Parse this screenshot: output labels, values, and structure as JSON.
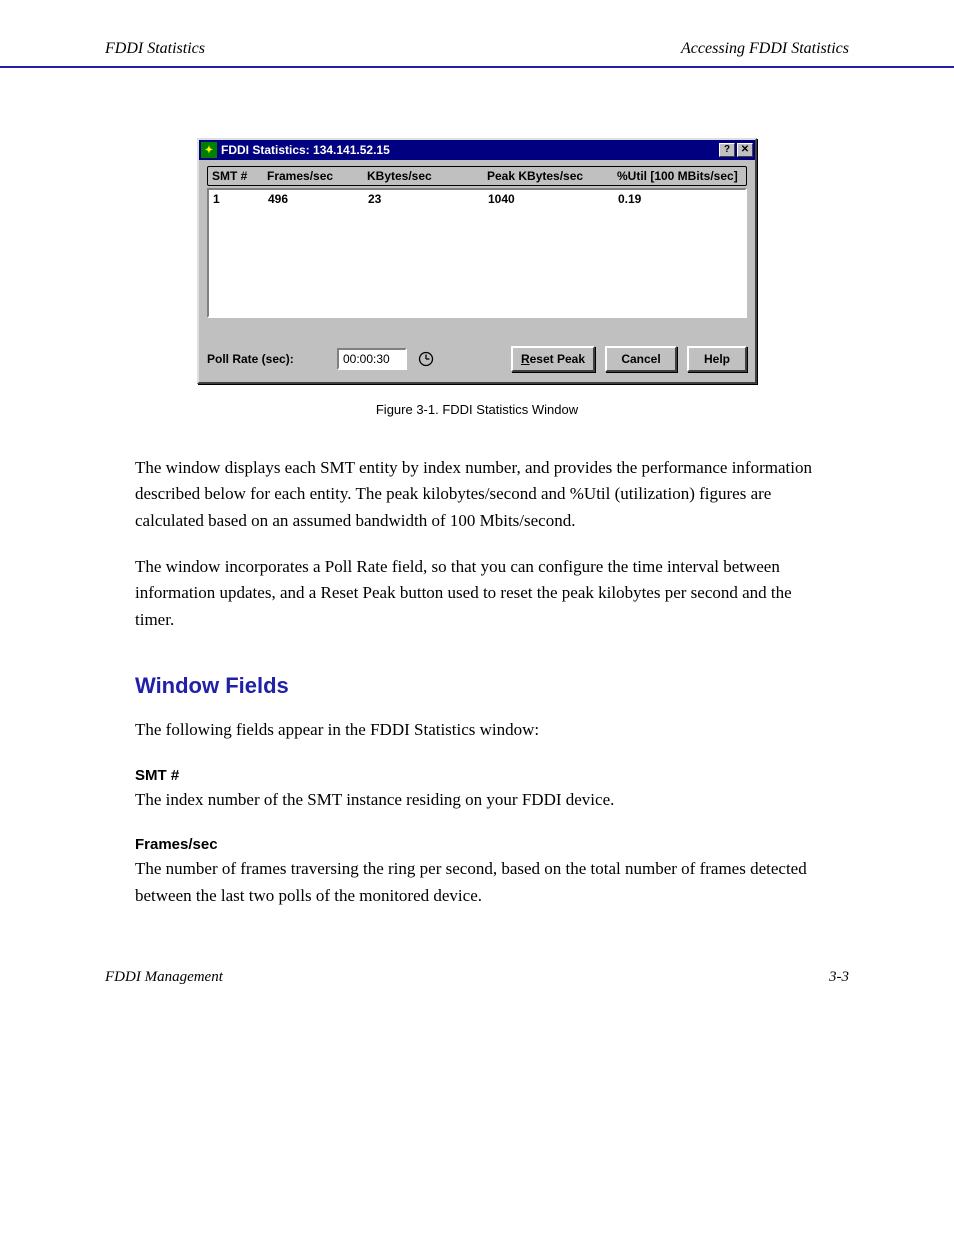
{
  "page_header": {
    "left": "FDDI Statistics",
    "right": "Accessing FDDI Statistics"
  },
  "dialog": {
    "title": "FDDI Statistics: 134.141.52.15",
    "columns": [
      "SMT #",
      "Frames/sec",
      "KBytes/sec",
      "Peak KBytes/sec",
      "%Util [100 MBits/sec]"
    ],
    "rows": [
      {
        "smt": "1",
        "fps": "496",
        "kbps": "23",
        "peak": "1040",
        "util": "0.19"
      }
    ],
    "poll_label": "Poll Rate (sec):",
    "poll_value": "00:00:30",
    "buttons": {
      "reset_peak_u": "R",
      "reset_peak_rest": "eset Peak",
      "cancel": "Cancel",
      "help": "Help"
    }
  },
  "caption": "Figure 3-1. FDDI Statistics Window",
  "body": {
    "p1": "The window displays each SMT entity by index number, and provides the performance information described below for each entity. The peak kilobytes/second and %Util (utilization) figures are calculated based on an assumed bandwidth of 100 Mbits/second.",
    "p2": "The window incorporates a Poll Rate field, so that you can configure the time interval between information updates, and a Reset Peak button used to reset the peak kilobytes per second and the timer.",
    "section": "Window Fields",
    "p3": "The following fields appear in the FDDI Statistics window:",
    "field1_name": "SMT #",
    "field1_desc": "The index number of the SMT instance residing on your FDDI device.",
    "field2_name": "Frames/sec",
    "field2_desc": "The number of frames traversing the ring per second, based on the total number of frames detected between the last two polls of the monitored device."
  },
  "page_footer_left": "FDDI Management",
  "page_footer_right": "3-3"
}
